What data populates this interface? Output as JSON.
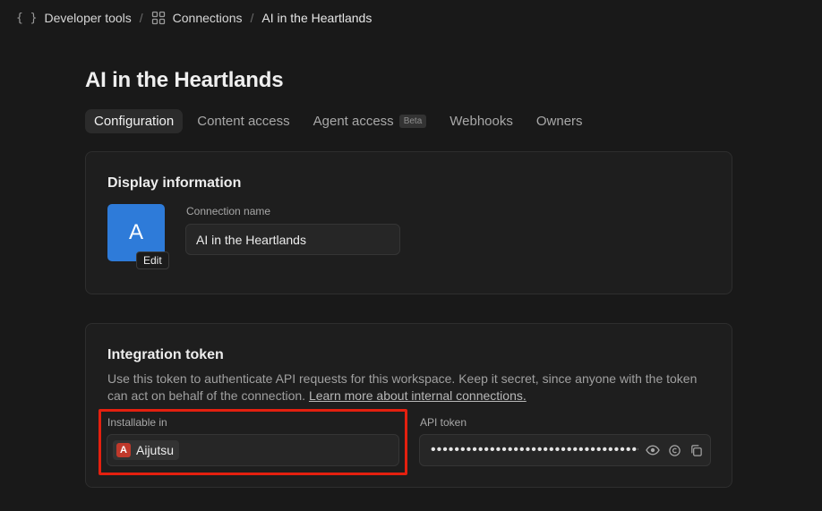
{
  "breadcrumb": {
    "items": [
      {
        "label": "Developer tools",
        "icon": "braces-icon"
      },
      {
        "label": "Connections",
        "icon": "grid-icon"
      },
      {
        "label": "AI in the Heartlands"
      }
    ],
    "separator": "/"
  },
  "page": {
    "title": "AI in the Heartlands"
  },
  "tabs": [
    {
      "label": "Configuration",
      "active": true
    },
    {
      "label": "Content access"
    },
    {
      "label": "Agent access",
      "badge": "Beta"
    },
    {
      "label": "Webhooks"
    },
    {
      "label": "Owners"
    }
  ],
  "display_info": {
    "title": "Display information",
    "avatar_letter": "A",
    "edit_label": "Edit",
    "connection_name_label": "Connection name",
    "connection_name_value": "AI in the Heartlands"
  },
  "integration_token": {
    "title": "Integration token",
    "description": "Use this token to authenticate API requests for this workspace. Keep it secret, since anyone with the token can act on behalf of the connection.",
    "learn_more": "Learn more about internal connections.",
    "installable_label": "Installable in",
    "workspace_name": "Aijutsu",
    "workspace_logo_letter": "A",
    "api_token_label": "API token",
    "api_token_masked": "••••••••••••••••••••••••••••••••••••"
  },
  "colors": {
    "background": "#191919",
    "card": "#1e1e1e",
    "avatar": "#2e7bd9",
    "workspace_logo": "#c0392b",
    "highlight": "#e4200f"
  }
}
